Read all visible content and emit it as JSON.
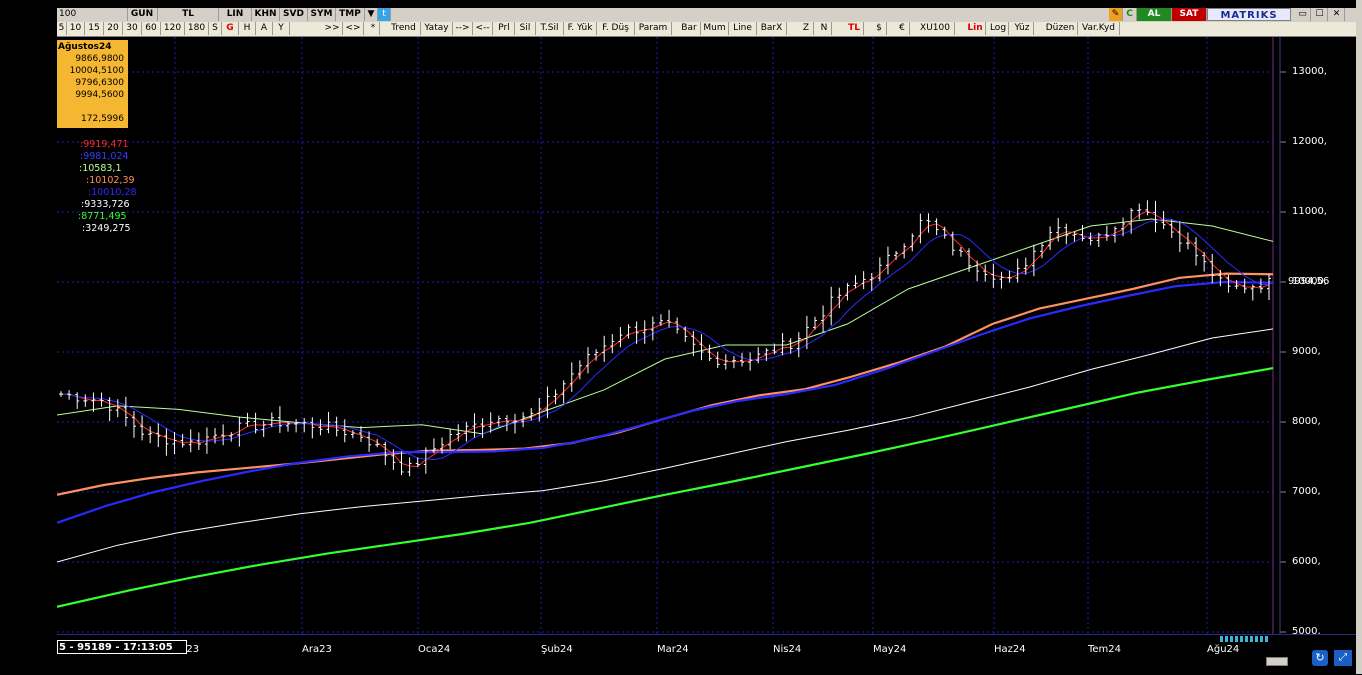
{
  "toolbar_top": {
    "symbol": "100",
    "buttons": [
      "GUN",
      "TL",
      "LIN",
      "KHN",
      "SVD",
      "SYM",
      "TMP"
    ],
    "buy_label": "AL",
    "sell_label": "SAT",
    "logo": "MATRIKS"
  },
  "toolbar_periods": [
    "5",
    "10",
    "15",
    "20",
    "30",
    "60",
    "120",
    "180",
    "S",
    "G",
    "H",
    "A",
    "Y"
  ],
  "toolbar_tools": [
    ">>",
    "<>",
    "*",
    "Trend",
    "Yatay",
    "-->",
    "<--",
    "Prl",
    "Sil",
    "T.Sil",
    "F. Yük",
    "F. Düş",
    "Param",
    "Bar",
    "Mum",
    "Line",
    "BarX",
    "Z",
    "N",
    "TL",
    "$",
    "€",
    "XU100",
    "Lin",
    "Log",
    "Yüz",
    "Düzen",
    "Var.Kyd"
  ],
  "info_box": {
    "period": "Ağustos24",
    "open": "9866,9800",
    "high": "10004,5100",
    "low": "9796,6300",
    "close": "9994,5600",
    "volume": "172,5996"
  },
  "indicators": [
    {
      "value": ":9919,471",
      "color": "#ff2a2a"
    },
    {
      "value": ":9981,024",
      "color": "#3a3aff"
    },
    {
      "value": ":10583,1",
      "color": "#b8ff9a"
    },
    {
      "value": ":10102,39",
      "color": "#ff9060"
    },
    {
      "value": ":10010,28",
      "color": "#2a2aff"
    },
    {
      "value": ":9333,726",
      "color": "#ffffff"
    },
    {
      "value": ":8771,495",
      "color": "#33ff33"
    },
    {
      "value": ":3249,275",
      "color": "#ffffff"
    }
  ],
  "last_price_label": "9994,56",
  "status_text": "5 - 95189 - 17:13:05",
  "colors": {
    "grid": "#1c1cb4",
    "bars": "#ffffff",
    "ma_short": "#ff2a2a",
    "ma_blue": "#2a2aff",
    "ma_light_green": "#b8ff9a",
    "ma_orange": "#ff9060",
    "ma_white": "#ffffff",
    "ma_green": "#33ff33"
  },
  "chart_data": {
    "type": "ohlc",
    "y_ticks": [
      "13000,",
      "12000,",
      "11000,",
      "10000,",
      "9000,",
      "8000,",
      "7000,",
      "6000,",
      "5000,"
    ],
    "x_ticks": [
      "as23",
      "Ara23",
      "Oca24",
      "Şub24",
      "Mar24",
      "Nis24",
      "May24",
      "Haz24",
      "Tem24",
      "Ağu24"
    ],
    "ylim": [
      5000,
      13500
    ],
    "grid": true,
    "series": [
      {
        "name": "ma_orange",
        "values": [
          6960,
          7100,
          7200,
          7280,
          7340,
          7400,
          7470,
          7540,
          7590,
          7600,
          7620,
          7700,
          7850,
          8050,
          8240,
          8380,
          8470,
          8650,
          8850,
          9080,
          9400,
          9620,
          9760,
          9900,
          10060,
          10120,
          10110
        ]
      },
      {
        "name": "ma_blue_long",
        "values": [
          6560,
          6800,
          7000,
          7160,
          7300,
          7420,
          7510,
          7570,
          7570,
          7580,
          7630,
          7760,
          7950,
          8150,
          8300,
          8400,
          8530,
          8750,
          9000,
          9250,
          9480,
          9650,
          9800,
          9940,
          10000,
          9990
        ]
      },
      {
        "name": "ma_white",
        "values": [
          6000,
          6240,
          6420,
          6560,
          6690,
          6790,
          6870,
          6950,
          7020,
          7160,
          7340,
          7530,
          7720,
          7880,
          8060,
          8280,
          8500,
          8750,
          8970,
          9200,
          9330
        ]
      },
      {
        "name": "ma_green",
        "values": [
          5360,
          5580,
          5780,
          5960,
          6120,
          6260,
          6400,
          6560,
          6760,
          6960,
          7150,
          7350,
          7550,
          7760,
          7980,
          8200,
          8420,
          8600,
          8770
        ]
      },
      {
        "name": "ma_light_green",
        "values": [
          8100,
          8230,
          8180,
          8070,
          7990,
          7920,
          7960,
          7830,
          8150,
          8460,
          8900,
          9100,
          9100,
          9400,
          9900,
          10200,
          10500,
          10800,
          10900,
          10800,
          10580
        ]
      },
      {
        "name": "price",
        "values": [
          8400,
          8300,
          7800,
          7700,
          7900,
          8000,
          7950,
          7800,
          7300,
          7800,
          8050,
          8100,
          8800,
          9300,
          9400,
          8900,
          8900,
          9150,
          9800,
          10200,
          10900,
          10300,
          10000,
          10800,
          10600,
          11100,
          10600,
          9900,
          9990
        ]
      }
    ]
  }
}
